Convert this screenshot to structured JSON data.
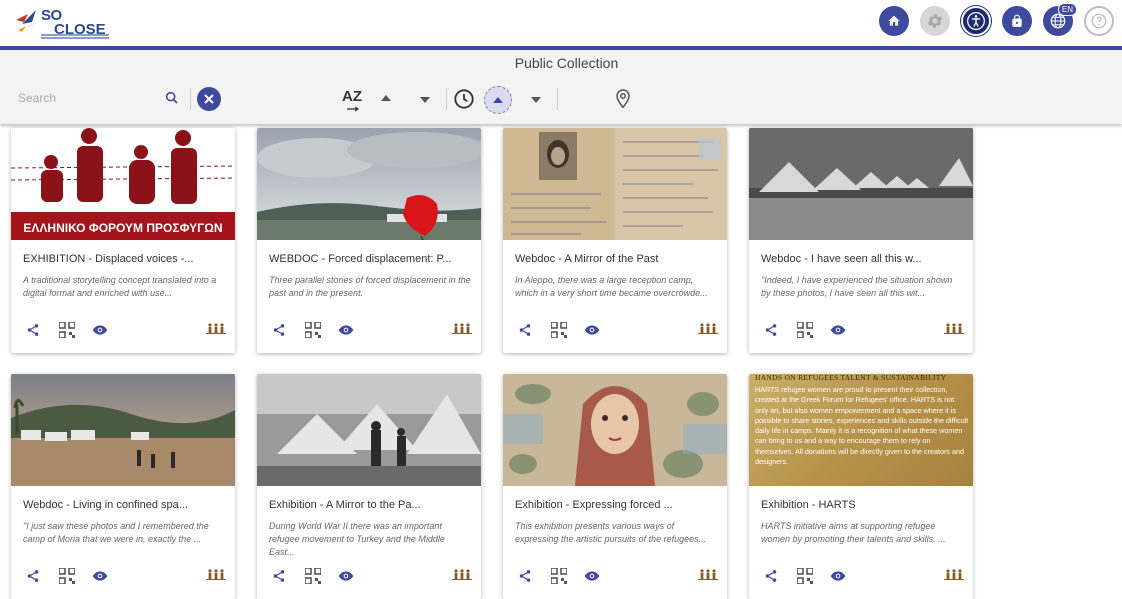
{
  "app": {
    "logo_line1": "SO",
    "logo_line2": "CLOSE"
  },
  "header": {
    "language_badge": "EN",
    "icons": [
      "home-icon",
      "gear-icon",
      "accessibility-icon",
      "lock-icon",
      "globe-icon",
      "help-icon"
    ],
    "accent_color": "#3f4a9e"
  },
  "toolbar": {
    "title": "Public Collection",
    "search_placeholder": "Search",
    "sort_alpha_label": "AZ"
  },
  "cards": [
    {
      "title": "EXHIBITION - Displaced voices -...",
      "desc": "A traditional storytelling concept translated into a digital format and enriched with use...",
      "image_caption": "ΕΛΛΗΝΙΚΟ ΦΟΡΟΥΜ ΠΡΟΣΦΥΓΩΝ"
    },
    {
      "title": "WEBDOC - Forced displacement: P...",
      "desc": "Three parallel stories of forced displacement in the past and in the present."
    },
    {
      "title": "Webdoc - A Mirror of the Past",
      "desc": "In Aleppo, there was a large reception camp, which in a very short time became overcrowde..."
    },
    {
      "title": "Webdoc - I have seen all this w...",
      "desc": "\"Indeed, I have experienced the situation shown by these photos, I have seen all this wit..."
    },
    {
      "title": "Webdoc - Living in confined spa...",
      "desc": "\"I just saw these photos and I remembered the camp of Moria that we were in, exactly the ..."
    },
    {
      "title": "Exhibition - A Mirror to the Pa...",
      "desc": "During World War II there was an important refugee movement to Turkey and the Middle East..."
    },
    {
      "title": "Exhibition - Expressing forced ...",
      "desc": "This exhibition presents various ways of expressing the artistic pursuits of the refugees..."
    },
    {
      "title": "Exhibition - HARTS",
      "desc": "HARTS initiative aims at supporting refugee women by promoting their talents and skills. ...",
      "image_heading": "HANDS ON REFUGEES TALENT & SUSTAINABILITY",
      "image_text": "HARTS refugee women are proud to present their collection, created at the Greek Forum for Refugees' office. HARTS is not only art, but also women empowerment and a space where it is possible to share stories, experiences and skills outside the difficult daily life in camps. Mainly it is a recognition of what these women can bring to us and a way to encourage them to rely on themselves. All donations will be directly given to the creators and designers."
    }
  ]
}
